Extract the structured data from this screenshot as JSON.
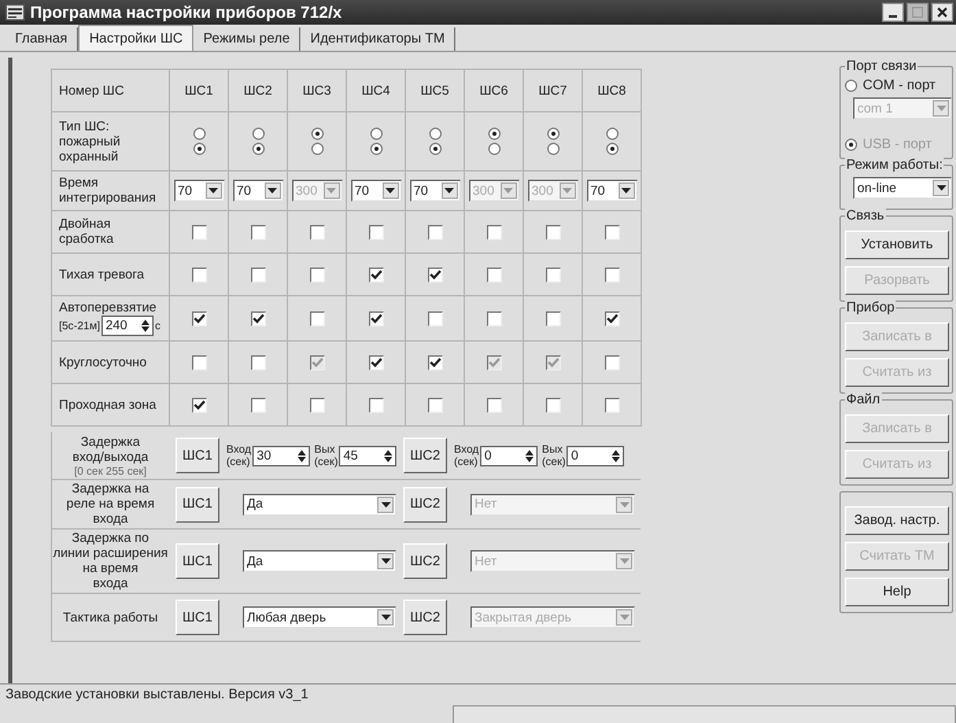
{
  "window": {
    "title": "Программа настройки приборов 712/х"
  },
  "tabs": [
    {
      "label": "Главная",
      "selected": false
    },
    {
      "label": "Настройки ШС",
      "selected": true
    },
    {
      "label": "Режимы реле",
      "selected": false
    },
    {
      "label": "Идентификаторы ТМ",
      "selected": false
    }
  ],
  "grid": {
    "header_label": "Номер ШС",
    "columns": [
      "ШС1",
      "ШС2",
      "ШС3",
      "ШС4",
      "ШС5",
      "ШС6",
      "ШС7",
      "ШС8"
    ],
    "rows": [
      {
        "kind": "radio",
        "label": "Тип ШС:\nпожарный\nохранный",
        "cells": [
          {
            "options": [
              {
                "selected": false
              },
              {
                "selected": true
              }
            ]
          },
          {
            "options": [
              {
                "selected": false
              },
              {
                "selected": true
              }
            ]
          },
          {
            "options": [
              {
                "selected": true
              },
              {
                "selected": false
              }
            ]
          },
          {
            "options": [
              {
                "selected": false
              },
              {
                "selected": true
              }
            ]
          },
          {
            "options": [
              {
                "selected": false
              },
              {
                "selected": true
              }
            ]
          },
          {
            "options": [
              {
                "selected": true
              },
              {
                "selected": false
              }
            ]
          },
          {
            "options": [
              {
                "selected": true
              },
              {
                "selected": false
              }
            ]
          },
          {
            "options": [
              {
                "selected": false
              },
              {
                "selected": true
              }
            ]
          }
        ]
      },
      {
        "kind": "select",
        "label": "Время\nинтегрирования",
        "cells": [
          {
            "value": "70",
            "disabled": false
          },
          {
            "value": "70",
            "disabled": false
          },
          {
            "value": "300",
            "disabled": true
          },
          {
            "value": "70",
            "disabled": false
          },
          {
            "value": "70",
            "disabled": false
          },
          {
            "value": "300",
            "disabled": true
          },
          {
            "value": "300",
            "disabled": true
          },
          {
            "value": "70",
            "disabled": false
          }
        ]
      },
      {
        "kind": "checkbox",
        "label": "Двойная\nсработка",
        "cells": [
          {
            "checked": false,
            "disabled": false
          },
          {
            "checked": false,
            "disabled": false
          },
          {
            "checked": false,
            "disabled": false
          },
          {
            "checked": false,
            "disabled": false
          },
          {
            "checked": false,
            "disabled": false
          },
          {
            "checked": false,
            "disabled": false
          },
          {
            "checked": false,
            "disabled": false
          },
          {
            "checked": false,
            "disabled": false
          }
        ]
      },
      {
        "kind": "checkbox",
        "label": "Тихая тревога",
        "cells": [
          {
            "checked": false,
            "disabled": false
          },
          {
            "checked": false,
            "disabled": false
          },
          {
            "checked": false,
            "disabled": false
          },
          {
            "checked": true,
            "disabled": false
          },
          {
            "checked": true,
            "disabled": false
          },
          {
            "checked": false,
            "disabled": false
          },
          {
            "checked": false,
            "disabled": false
          },
          {
            "checked": false,
            "disabled": false
          }
        ]
      },
      {
        "kind": "checkbox_spin",
        "label": "Автоперевзятие",
        "range": "[5с-21м]",
        "value": "240",
        "unit": "с",
        "cells": [
          {
            "checked": true,
            "disabled": false
          },
          {
            "checked": true,
            "disabled": false
          },
          {
            "checked": false,
            "disabled": false
          },
          {
            "checked": true,
            "disabled": false
          },
          {
            "checked": false,
            "disabled": false
          },
          {
            "checked": false,
            "disabled": false
          },
          {
            "checked": false,
            "disabled": false
          },
          {
            "checked": true,
            "disabled": false
          }
        ]
      },
      {
        "kind": "checkbox",
        "label": "Круглосуточно",
        "cells": [
          {
            "checked": false,
            "disabled": false
          },
          {
            "checked": false,
            "disabled": false
          },
          {
            "checked": true,
            "disabled": true
          },
          {
            "checked": true,
            "disabled": false
          },
          {
            "checked": true,
            "disabled": false
          },
          {
            "checked": true,
            "disabled": true
          },
          {
            "checked": true,
            "disabled": true
          },
          {
            "checked": false,
            "disabled": false
          }
        ]
      },
      {
        "kind": "checkbox",
        "label": "Проходная зона",
        "cells": [
          {
            "checked": true,
            "disabled": false
          },
          {
            "checked": false,
            "disabled": false
          },
          {
            "checked": false,
            "disabled": false
          },
          {
            "checked": false,
            "disabled": false
          },
          {
            "checked": false,
            "disabled": false
          },
          {
            "checked": false,
            "disabled": false
          },
          {
            "checked": false,
            "disabled": false
          },
          {
            "checked": false,
            "disabled": false
          }
        ]
      }
    ]
  },
  "delays": [
    {
      "kind": "spins",
      "label": "Задержка\nвход/выхода",
      "note": "[0 сек 255 сек]",
      "groups": [
        {
          "button": "ШС1",
          "fields": [
            {
              "label": "Вход\n(сек)",
              "value": "30"
            },
            {
              "label": "Вых\n(сек)",
              "value": "45"
            }
          ]
        },
        {
          "button": "ШС2",
          "fields": [
            {
              "label": "Вход\n(сек)",
              "value": "0"
            },
            {
              "label": "Вых\n(сек)",
              "value": "0"
            }
          ]
        }
      ]
    },
    {
      "kind": "select",
      "label": "Задержка на\nреле на время\nвхода",
      "groups": [
        {
          "button": "ШС1",
          "value": "Да",
          "disabled": false
        },
        {
          "button": "ШС2",
          "value": "Нет",
          "disabled": true
        }
      ]
    },
    {
      "kind": "select",
      "label": "Задержка по\nлинии расширения\nна время\nвхода",
      "groups": [
        {
          "button": "ШС1",
          "value": "Да",
          "disabled": false
        },
        {
          "button": "ШС2",
          "value": "Нет",
          "disabled": true
        }
      ]
    },
    {
      "kind": "select",
      "label": "Тактика работы",
      "groups": [
        {
          "button": "ШС1",
          "value": "Любая дверь",
          "disabled": false
        },
        {
          "button": "ШС2",
          "value": "Закрытая дверь",
          "disabled": true
        }
      ]
    }
  ],
  "side": {
    "port": {
      "title": "Порт связи",
      "options": [
        {
          "label": "COM - порт",
          "selected": false,
          "disabled": false
        },
        {
          "label": "USB - порт",
          "selected": true,
          "disabled": true
        }
      ],
      "select": {
        "value": "com 1",
        "disabled": true
      }
    },
    "mode": {
      "title": "Режим работы:",
      "value": "on-line"
    },
    "groups": [
      {
        "title": "Связь",
        "buttons": [
          {
            "label": "Установить",
            "disabled": false
          },
          {
            "label": "Разорвать",
            "disabled": true
          }
        ]
      },
      {
        "title": "Прибор",
        "buttons": [
          {
            "label": "Записать в",
            "disabled": true
          },
          {
            "label": "Считать из",
            "disabled": true
          }
        ]
      },
      {
        "title": "Файл",
        "buttons": [
          {
            "label": "Записать в",
            "disabled": true
          },
          {
            "label": "Считать из",
            "disabled": true
          }
        ]
      }
    ],
    "buttons": [
      {
        "label": "Завод. настр.",
        "disabled": false
      },
      {
        "label": "Считать ТМ",
        "disabled": true
      },
      {
        "label": "Help",
        "disabled": false
      }
    ]
  },
  "status_bar": {
    "text": "Заводские установки выставлены. Версия v3_1"
  }
}
